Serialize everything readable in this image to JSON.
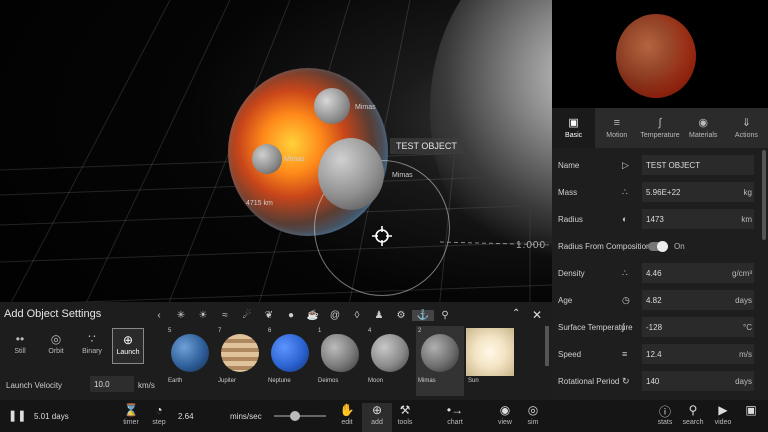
{
  "scene": {
    "selected_label": "TEST OBJECT",
    "body_labels": [
      "Mimas",
      "Mimas",
      "Mimas"
    ],
    "distance_label": "4715 km",
    "scale_label": "1.000"
  },
  "right_panel": {
    "tabs": [
      {
        "label": "Basic",
        "icon": "bookmark-icon"
      },
      {
        "label": "Motion",
        "icon": "motion-icon"
      },
      {
        "label": "Temperature",
        "icon": "thermometer-icon"
      },
      {
        "label": "Materials",
        "icon": "materials-icon"
      },
      {
        "label": "Actions",
        "icon": "actions-icon"
      }
    ],
    "properties": {
      "name": {
        "label": "Name",
        "value": "TEST OBJECT",
        "unit": ""
      },
      "mass": {
        "label": "Mass",
        "value": "5.96E+22",
        "unit": "kg"
      },
      "radius": {
        "label": "Radius",
        "value": "1473",
        "unit": "km"
      },
      "radius_comp": {
        "label": "Radius From Composition",
        "state": "On"
      },
      "density": {
        "label": "Density",
        "value": "4.46",
        "unit": "g/cm³"
      },
      "age": {
        "label": "Age",
        "value": "4.82",
        "unit": "days"
      },
      "surface_temp": {
        "label": "Surface Temperature",
        "value": "-128",
        "unit": "°C"
      },
      "speed": {
        "label": "Speed",
        "value": "12.4",
        "unit": "m/s"
      },
      "rot_period": {
        "label": "Rotational Period",
        "value": "140",
        "unit": "days"
      }
    }
  },
  "add_panel": {
    "title": "Add Object Settings",
    "modes": [
      {
        "label": "Still"
      },
      {
        "label": "Orbit"
      },
      {
        "label": "Binary"
      },
      {
        "label": "Launch"
      }
    ],
    "velocity_label": "Launch Velocity",
    "velocity_value": "10.0",
    "velocity_unit": "km/s",
    "objects": [
      {
        "num": "5",
        "name": "Earth",
        "color": "#2f5f9a"
      },
      {
        "num": "7",
        "name": "Jupiter",
        "color": "#c8a57a"
      },
      {
        "num": "6",
        "name": "Neptune",
        "color": "#2b63d1"
      },
      {
        "num": "1",
        "name": "Deimos",
        "color": "#7a7a7a"
      },
      {
        "num": "4",
        "name": "Moon",
        "color": "#8a8a8a"
      },
      {
        "num": "2",
        "name": "Mimas",
        "color": "#6e6e6e"
      },
      {
        "num": "",
        "name": "Sun",
        "color": "#f3e4c4"
      }
    ]
  },
  "toolbar": {
    "time": "5.01 days",
    "speed_value": "2.64",
    "speed_unit": "mins/sec",
    "buttons": {
      "timer": "timer",
      "step": "step",
      "edit": "edit",
      "add": "add",
      "tools": "tools",
      "chart": "chart",
      "view": "view",
      "sim": "sim",
      "stats": "stats",
      "search": "search",
      "video": "video"
    }
  }
}
